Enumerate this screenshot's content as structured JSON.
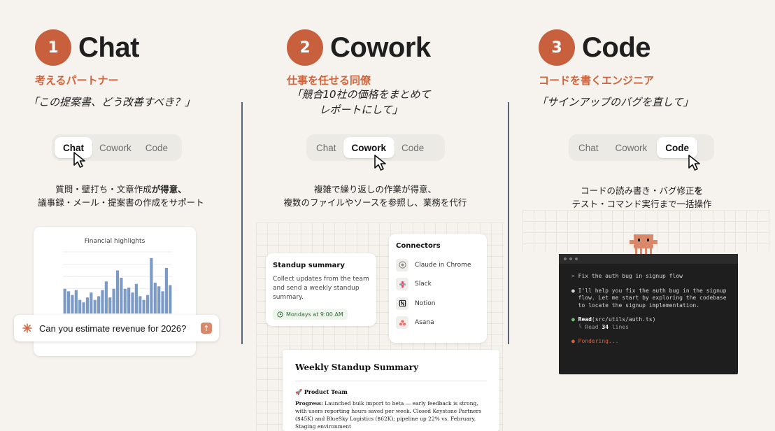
{
  "colors": {
    "accent": "#c8603e",
    "subtitle_accent": "#d0643c",
    "background": "#f6f3ef",
    "chart_bar": "#7b9ac6",
    "terminal_bg": "#1e1e1e",
    "mascot": "#d9886a"
  },
  "columns": [
    {
      "number": "1",
      "title": "Chat",
      "subtitle": "考えるパートナー",
      "quote": "「この提案書、どう改善すべき？」",
      "switcher": {
        "options": [
          "Chat",
          "Cowork",
          "Code"
        ],
        "active": "Chat"
      },
      "desc_line1_a": "質問・壁打ち・文章作成",
      "desc_line1_b": "が得意、",
      "desc_line2": "議事録・メール・提案書の作成をサポート",
      "mock": {
        "chart_title": "Financial highlights",
        "prompt_text": "Can you estimate revenue for 2026?",
        "prompt_icon": "sparkle-icon",
        "send_icon": "arrow-up-icon"
      }
    },
    {
      "number": "2",
      "title": "Cowork",
      "subtitle": "仕事を任せる同僚",
      "quote_line1": "「競合10社の価格をまとめて",
      "quote_line2": "レポートにして」",
      "switcher": {
        "options": [
          "Chat",
          "Cowork",
          "Code"
        ],
        "active": "Cowork"
      },
      "desc_line1": "複雑で繰り返しの作業が得意、",
      "desc_line2": "複数のファイルやソースを参照し、業務を代行",
      "mock": {
        "standup_title": "Standup summary",
        "standup_body": "Collect updates from the team and send a weekly standup summary.",
        "schedule": "Mondays at 9:00 AM",
        "connectors_title": "Connectors",
        "connectors": [
          {
            "label": "Claude in Chrome",
            "icon": "chrome-icon"
          },
          {
            "label": "Slack",
            "icon": "slack-icon"
          },
          {
            "label": "Notion",
            "icon": "notion-icon"
          },
          {
            "label": "Asana",
            "icon": "asana-icon"
          }
        ],
        "weekly_title": "Weekly Standup Summary",
        "weekly_team": "🚀 Product Team",
        "weekly_label": "Progress:",
        "weekly_text": "Launched bulk import to beta — early feedback is strong, with users reporting hours saved per week. Closed Keystone Partners ($45K) and BlueSky Logistics ($62K); pipeline up 22% vs. February. Staging environment"
      }
    },
    {
      "number": "3",
      "title": "Code",
      "subtitle": "コードを書くエンジニア",
      "quote": "「サインアップのバグを直して」",
      "switcher": {
        "options": [
          "Chat",
          "Cowork",
          "Code"
        ],
        "active": "Code"
      },
      "desc_line1_a": "コードの読み書き・バグ修正",
      "desc_line1_b": "を",
      "desc_line2": "テスト・コマンド実行まで一括操作",
      "mock": {
        "line1": "Fix the auth bug in signup flow",
        "line2": "I'll help you fix the auth bug in the signup",
        "line3": "flow. Let me start by exploring the codebase",
        "line4": "to locate the signup implementation.",
        "read_label": "Read",
        "read_path": "(src/utils/auth.ts)",
        "read_result_a": "Read ",
        "read_result_n": "34",
        "read_result_b": " lines",
        "status": "Pondering..."
      }
    }
  ],
  "chart_data": {
    "type": "bar",
    "title": "Financial highlights",
    "xlabel": "",
    "ylabel": "",
    "values": [
      40,
      36,
      30,
      38,
      22,
      18,
      26,
      34,
      22,
      28,
      38,
      52,
      26,
      40,
      70,
      58,
      40,
      42,
      34,
      48,
      28,
      22,
      30,
      90,
      50,
      44,
      36,
      74,
      46
    ],
    "ylim": [
      0,
      100
    ],
    "grid": true
  }
}
